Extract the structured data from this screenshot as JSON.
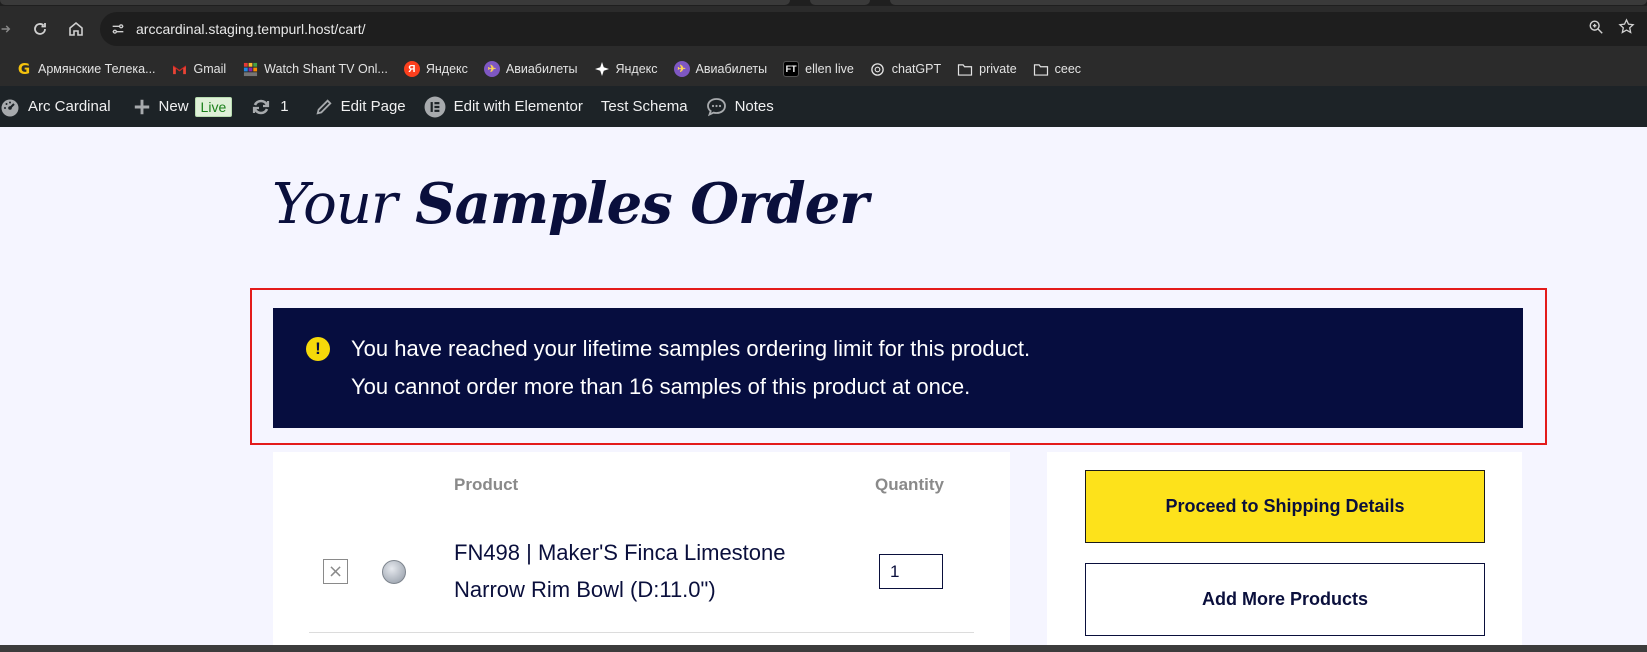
{
  "browser": {
    "url": "arccardinal.staging.tempurl.host/cart/",
    "bookmarks": [
      {
        "label": "Армянские Телека...",
        "icon": "google-g-icon"
      },
      {
        "label": "Gmail",
        "icon": "gmail-icon"
      },
      {
        "label": "Watch Shant TV Onl...",
        "icon": "tv-icon"
      },
      {
        "label": "Яндекс",
        "icon": "yandex-icon"
      },
      {
        "label": "Авиабилеты",
        "icon": "globe-icon"
      },
      {
        "label": "Яндекс",
        "icon": "sparkle-icon"
      },
      {
        "label": "Авиабилеты",
        "icon": "globe-icon"
      },
      {
        "label": "ellen live",
        "icon": "ft-icon"
      },
      {
        "label": "chatGPT",
        "icon": "openai-icon"
      },
      {
        "label": "private",
        "icon": "folder-icon"
      },
      {
        "label": "ceec",
        "icon": "folder-icon"
      }
    ]
  },
  "admin_bar": {
    "site_name": "Arc Cardinal",
    "new_label": "New",
    "live_label": "Live",
    "updates_count": "1",
    "edit_page": "Edit Page",
    "edit_elementor": "Edit with Elementor",
    "test_schema": "Test Schema",
    "notes": "Notes"
  },
  "page": {
    "title_light": "Your",
    "title_bold": "Samples Order",
    "notice": {
      "line1": "You have reached your lifetime samples ordering limit for this product.",
      "line2": "You cannot order more than 16 samples of this product at once."
    },
    "cart": {
      "col_product": "Product",
      "col_quantity": "Quantity",
      "items": [
        {
          "name": "FN498 | Maker'S Finca Limestone Narrow Rim Bowl (D:11.0\")",
          "quantity": "1"
        }
      ]
    },
    "summary": {
      "proceed_label": "Proceed to Shipping Details",
      "add_more_label": "Add More Products"
    }
  },
  "colors": {
    "navy": "#060d3f",
    "accent_yellow": "#fde21b",
    "highlight_red": "#e31b1b"
  }
}
